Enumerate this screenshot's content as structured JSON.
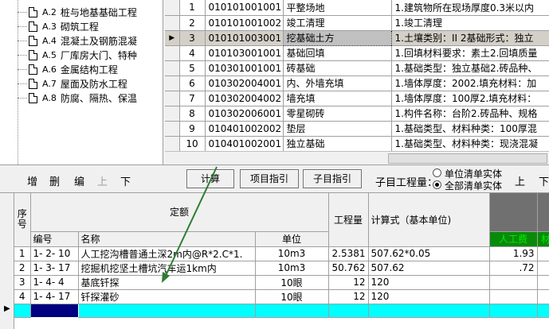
{
  "tree": {
    "items": [
      {
        "code": "A.2",
        "name": "桩与地基基础工程"
      },
      {
        "code": "A.3",
        "name": "砌筑工程"
      },
      {
        "code": "A.4",
        "name": "混凝土及钢筋混凝"
      },
      {
        "code": "A.5",
        "name": "厂库房大门、特种"
      },
      {
        "code": "A.6",
        "name": "金属结构工程"
      },
      {
        "code": "A.7",
        "name": "屋面及防水工程"
      },
      {
        "code": "A.8",
        "name": "防腐、隔热、保温"
      }
    ]
  },
  "top_grid": {
    "rows": [
      {
        "seq": "1",
        "code": "010101001001",
        "name": "平整场地",
        "desc": "1.建筑物所在现场厚度0.3米以内"
      },
      {
        "seq": "2",
        "code": "010101001002",
        "name": "竣工清理",
        "desc": "1.竣工清理"
      },
      {
        "seq": "3",
        "code": "010101003001",
        "name": "挖基础土方",
        "desc": "1.土壤类别：II 2基础形式：独立"
      },
      {
        "seq": "4",
        "code": "010103001001",
        "name": "基础回填",
        "desc": "1.回填材料要求：素土2.回填质量"
      },
      {
        "seq": "5",
        "code": "010301001001",
        "name": "砖基础",
        "desc": "1.基础类型：独立基础2.砖品种、"
      },
      {
        "seq": "6",
        "code": "010302004001",
        "name": "内、外墙充填",
        "desc": "1.墙体厚度：2002.填充材料：加"
      },
      {
        "seq": "7",
        "code": "010302004002",
        "name": "墙充填",
        "desc": "1.墙体厚度：100厚2.填充材料："
      },
      {
        "seq": "8",
        "code": "010302006001",
        "name": "零星砌砖",
        "desc": "1.构件名称：台阶2.砖品种、规格"
      },
      {
        "seq": "9",
        "code": "010401002002",
        "name": "垫层",
        "desc": "1.基础类型、材料种类：100厚混"
      },
      {
        "seq": "10",
        "code": "010401002001",
        "name": "独立基础",
        "desc": "1.基础类型、材料种类：现浇混凝"
      }
    ]
  },
  "toolbar": {
    "add": "增",
    "delete": "删",
    "edit": "编",
    "up": "上",
    "down": "下",
    "calc": "计算",
    "item_guide": "项目指引",
    "sub_guide": "子目指引",
    "sub_qty_label": "子目工程量：",
    "radio_unit": "单位清单实体",
    "radio_all": "全部清单实体",
    "up2": "上",
    "down2": "下"
  },
  "bottom_grid": {
    "headers": {
      "seq": "序号",
      "quota": "定额",
      "code": "编号",
      "name": "名称",
      "unit": "单位",
      "qty": "工程量",
      "formula": "计算式（基本单位)",
      "labor": "人工费",
      "material": "材料"
    },
    "rows": [
      {
        "seq": "1",
        "code": "1- 2- 10",
        "name": "人工挖沟槽普通土深2m内@R*2.C*1.",
        "unit": "10m3",
        "qty": "2.5381",
        "formula": "507.62*0.05",
        "labor": "1.93"
      },
      {
        "seq": "2",
        "code": "1- 3- 17",
        "name": "挖掘机挖坚土槽坑汽车运1km内",
        "unit": "10m3",
        "qty": "50.762",
        "formula": "507.62",
        "labor": ".72"
      },
      {
        "seq": "3",
        "code": "1- 4-  4",
        "name": "基底钎探",
        "unit": "10眼",
        "qty": "12",
        "formula": "120",
        "labor": ""
      },
      {
        "seq": "4",
        "code": "1- 4- 17",
        "name": "钎探灌砂",
        "unit": "10眼",
        "qty": "12",
        "formula": "120",
        "labor": ""
      }
    ]
  },
  "colors": {
    "selection_cyan": "#00ffff",
    "header_green": "#0a8a0a",
    "annotation_arrow": "#2e7d32"
  }
}
